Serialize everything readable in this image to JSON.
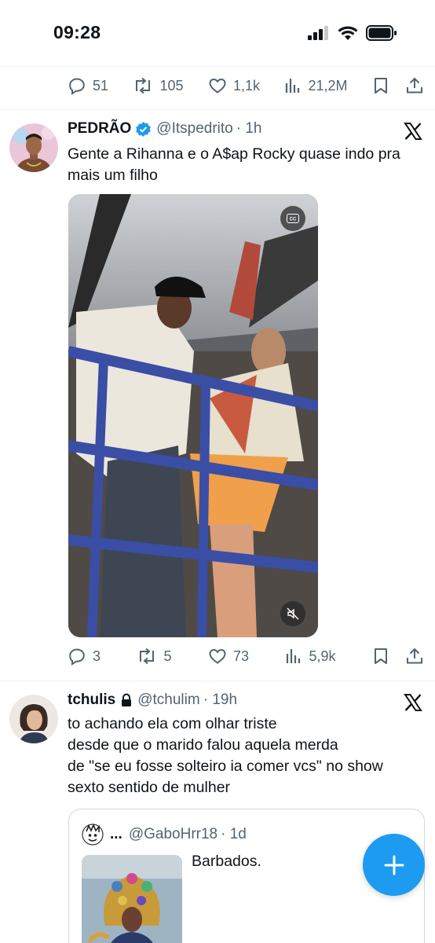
{
  "status_bar": {
    "time": "09:28",
    "icons": [
      "cellular-signal-icon",
      "wifi-icon",
      "battery-icon"
    ]
  },
  "first_tweet_actions": {
    "replies": "51",
    "reposts": "105",
    "likes": "1,1k",
    "views": "21,2M"
  },
  "tweet1": {
    "name": "PEDRÃO",
    "verified": true,
    "handle": "@Itspedrito",
    "time": "· 1h",
    "text_line1": "Gente a Rihanna e o A$ap Rocky quase indo pra",
    "text_line2": "mais um filho",
    "media": {
      "type": "video",
      "icons": [
        "closed-captions-icon",
        "muted-speaker-icon"
      ]
    },
    "actions": {
      "replies": "3",
      "reposts": "5",
      "likes": "73",
      "views": "5,9k"
    }
  },
  "tweet2": {
    "name": "tchulis",
    "protected": true,
    "handle": "@tchulim",
    "time": "· 19h",
    "text_lines": [
      "to achando ela com olhar triste",
      "desde que o marido falou aquela merda",
      "de \"se eu fosse solteiro ia comer vcs\" no show",
      "sexto sentido de mulher"
    ],
    "quote": {
      "name": "...",
      "handle": "@GaboHrr18",
      "time": "· 1d",
      "text": "Barbados."
    }
  },
  "colors": {
    "accent": "#1d9bf0",
    "text": "#0f1419",
    "secondary": "#536471",
    "divider": "#eff3f4"
  },
  "fab": {
    "icon": "plus-icon"
  }
}
